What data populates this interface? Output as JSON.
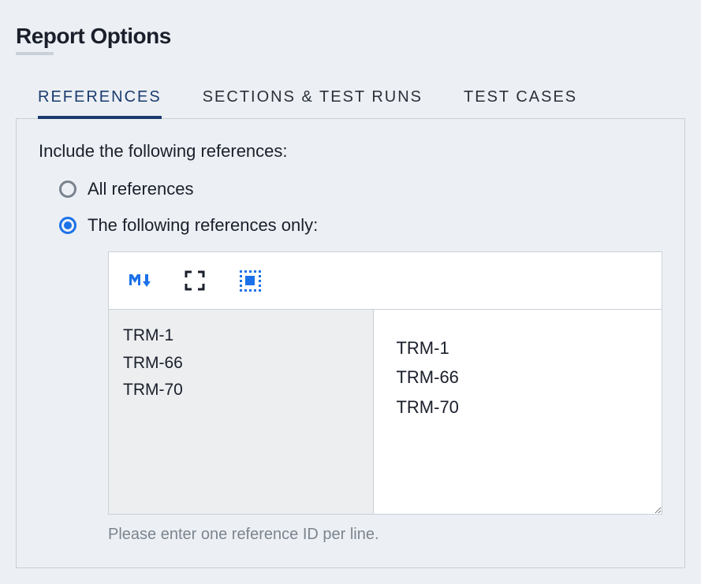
{
  "title": "Report Options",
  "tabs": [
    {
      "label": "REFERENCES",
      "active": true
    },
    {
      "label": "SECTIONS & TEST RUNS",
      "active": false
    },
    {
      "label": "TEST CASES",
      "active": false
    }
  ],
  "references": {
    "prompt": "Include the following references:",
    "options": {
      "all": {
        "label": "All references",
        "selected": false
      },
      "only": {
        "label": "The following references only:",
        "selected": true
      }
    },
    "editor": {
      "source_text": "TRM-1\nTRM-66\nTRM-70",
      "preview_text": "TRM-1\nTRM-66\nTRM-70",
      "hint": "Please enter one reference ID per line."
    }
  },
  "icons": {
    "markdown": "markdown-icon",
    "fullscreen": "fullscreen-icon",
    "selectall": "select-all-icon"
  }
}
